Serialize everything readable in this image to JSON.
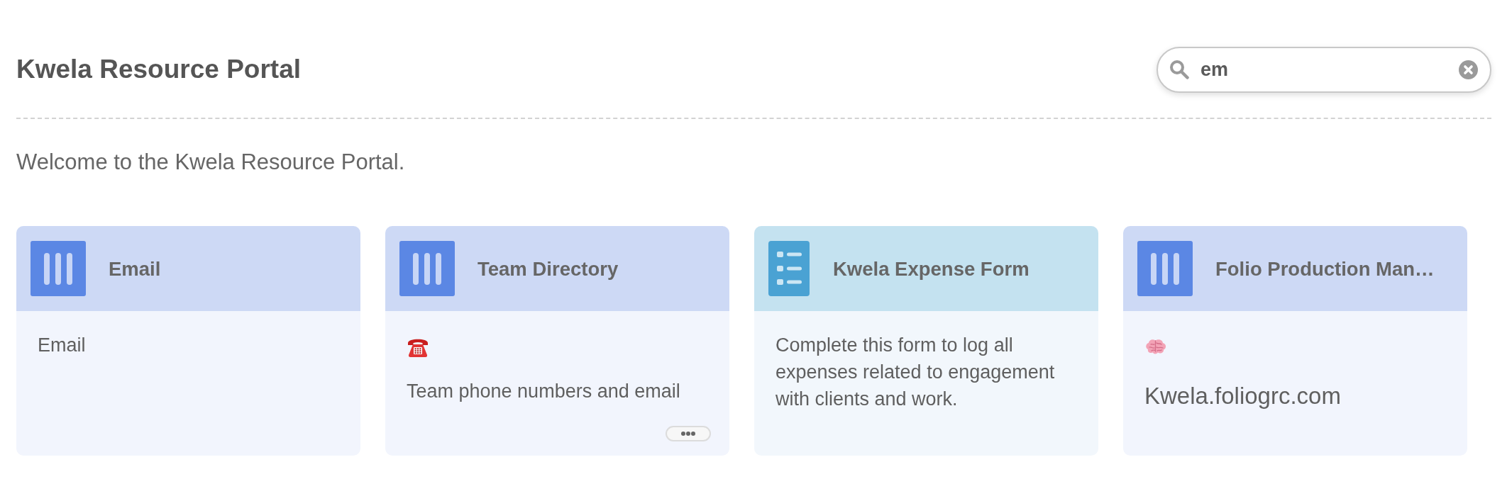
{
  "header": {
    "title": "Kwela Resource Portal",
    "search": {
      "value": "em"
    }
  },
  "welcome": "Welcome to the Kwela Resource Portal.",
  "cards": [
    {
      "kind": "app",
      "title": "Email",
      "truncated": false,
      "body": [
        {
          "kind": "text",
          "text": "Email"
        }
      ]
    },
    {
      "kind": "app",
      "title": "Team Directory",
      "truncated": true,
      "body": [
        {
          "kind": "telephone"
        },
        {
          "kind": "text",
          "text": "Team phone numbers and email"
        }
      ]
    },
    {
      "kind": "form",
      "title": "Kwela Expense Form",
      "truncated": false,
      "body": [
        {
          "kind": "text",
          "text": "Complete this form to log all expenses related to engagement with clients and work."
        }
      ]
    },
    {
      "kind": "app",
      "title": "Folio Production Man…",
      "truncated": false,
      "body": [
        {
          "kind": "brain"
        },
        {
          "kind": "large_text",
          "text": "Kwela.foliogrc.com"
        }
      ]
    }
  ]
}
